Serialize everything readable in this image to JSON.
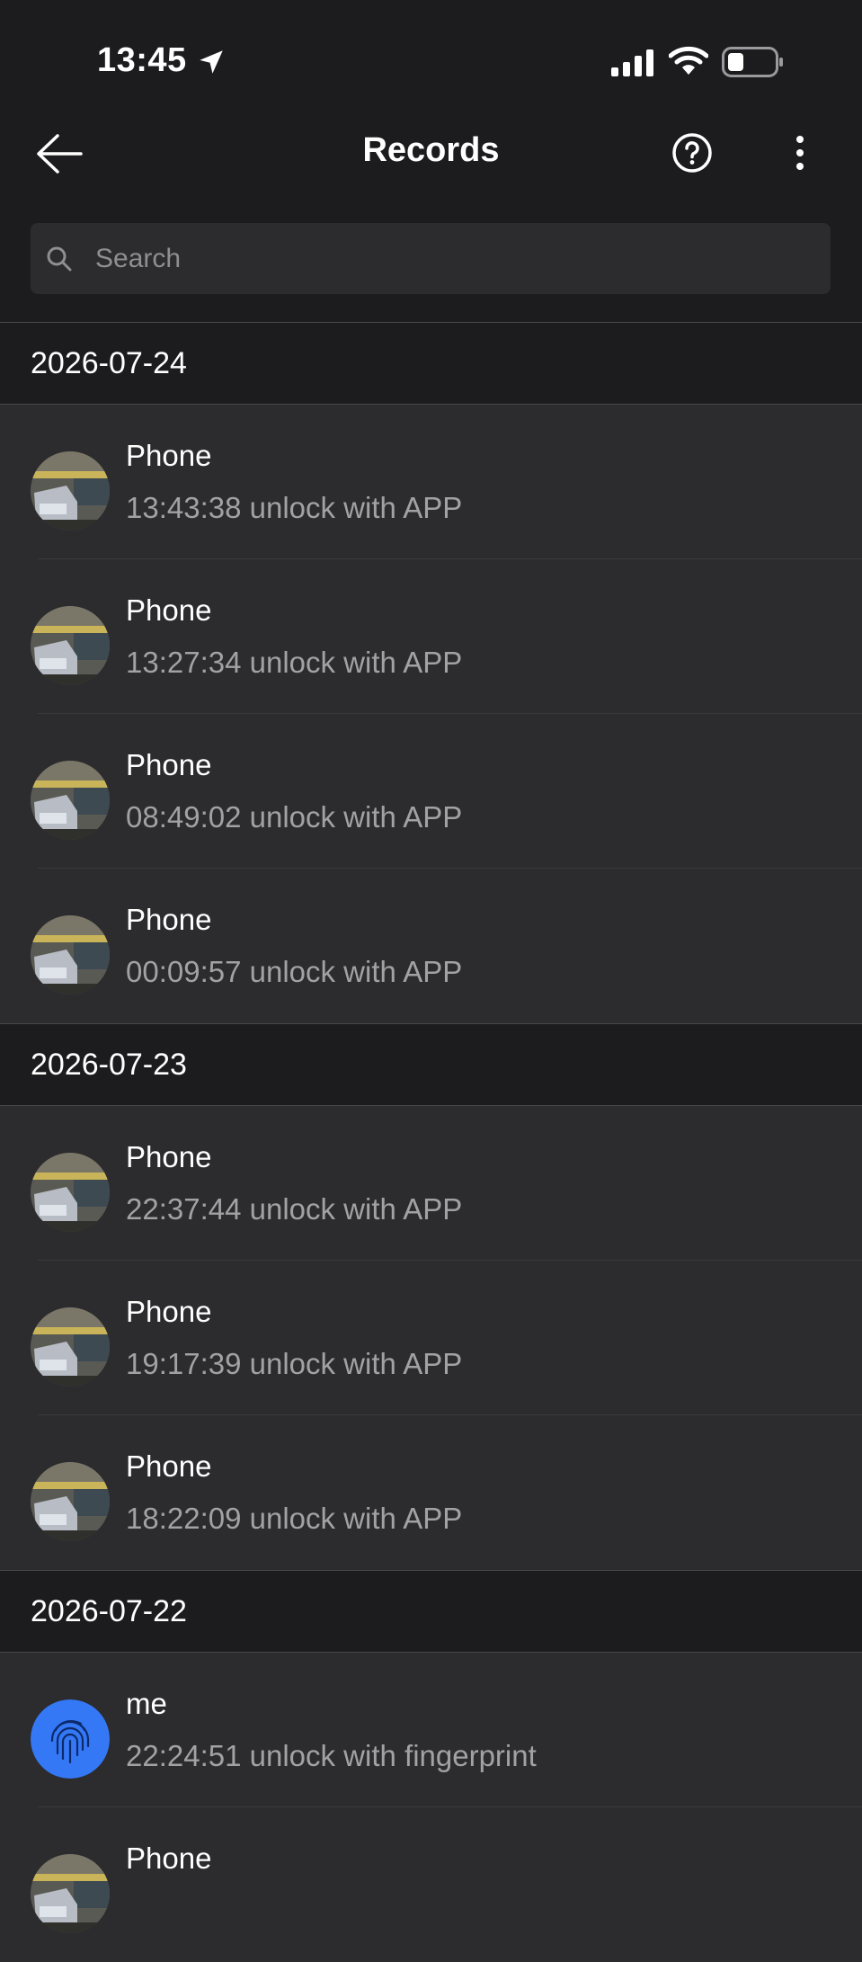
{
  "status_bar": {
    "time": "13:45"
  },
  "nav": {
    "title": "Records"
  },
  "search": {
    "placeholder": "Search"
  },
  "groups": [
    {
      "date": "2026-07-24",
      "records": [
        {
          "name": "Phone",
          "detail": "13:43:38 unlock with APP",
          "avatar": "camera-snapshot"
        },
        {
          "name": "Phone",
          "detail": "13:27:34 unlock with APP",
          "avatar": "camera-snapshot"
        },
        {
          "name": "Phone",
          "detail": "08:49:02 unlock with APP",
          "avatar": "camera-snapshot"
        },
        {
          "name": "Phone",
          "detail": "00:09:57 unlock with APP",
          "avatar": "camera-snapshot"
        }
      ]
    },
    {
      "date": "2026-07-23",
      "records": [
        {
          "name": "Phone",
          "detail": "22:37:44 unlock with APP",
          "avatar": "camera-snapshot"
        },
        {
          "name": "Phone",
          "detail": "19:17:39 unlock with APP",
          "avatar": "camera-snapshot"
        },
        {
          "name": "Phone",
          "detail": "18:22:09 unlock with APP",
          "avatar": "camera-snapshot"
        }
      ]
    },
    {
      "date": "2026-07-22",
      "records": [
        {
          "name": "me",
          "detail": "22:24:51 unlock with fingerprint",
          "avatar": "fingerprint-icon"
        },
        {
          "name": "Phone",
          "detail": "",
          "avatar": "camera-snapshot"
        }
      ]
    }
  ],
  "colors": {
    "background": "#1c1c1e",
    "row": "#2c2c2e",
    "fingerprint_avatar": "#3478f6",
    "secondary_text": "#a1a1a6"
  }
}
